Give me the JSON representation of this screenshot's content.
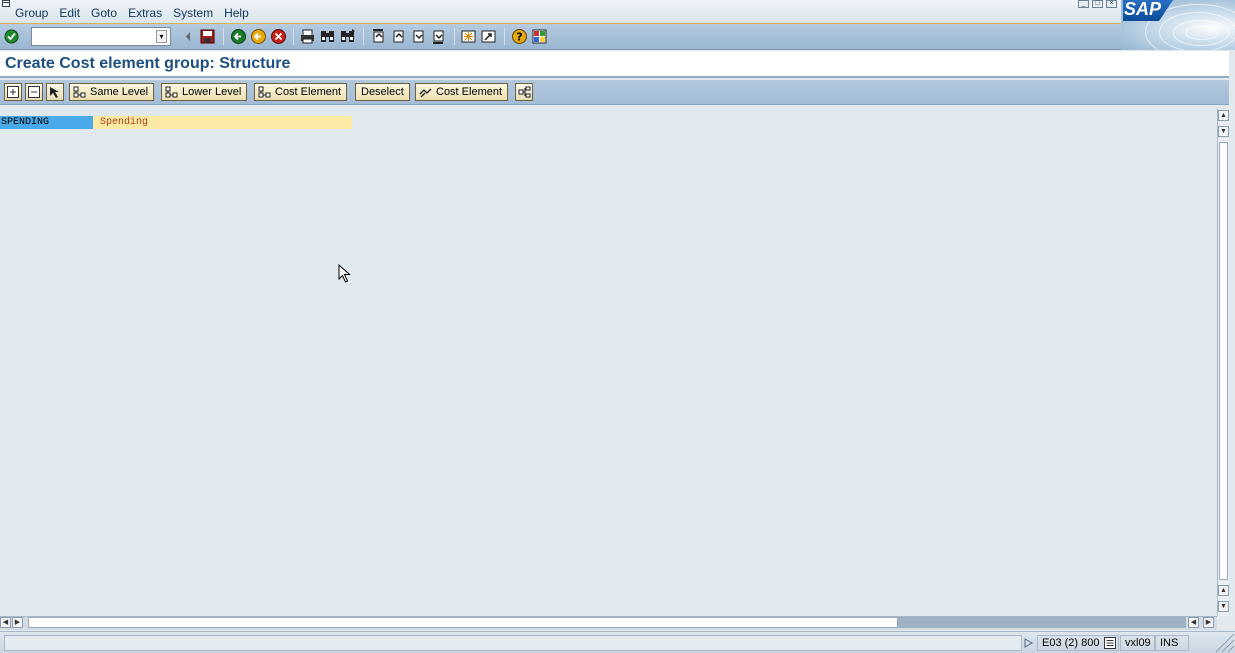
{
  "menubar": {
    "items": [
      "Group",
      "Edit",
      "Goto",
      "Extras",
      "System",
      "Help"
    ]
  },
  "branding": {
    "logo_text": "SAP"
  },
  "systoolbar": {
    "command_field_value": "",
    "icons": [
      "enter-icon",
      "back-icon",
      "save-icon",
      "back-nav-icon",
      "exit-icon",
      "cancel-icon",
      "print-icon",
      "find-icon",
      "find-next-icon",
      "first-page-icon",
      "previous-page-icon",
      "next-page-icon",
      "last-page-icon",
      "new-session-icon",
      "shortcut-icon",
      "help-icon",
      "customize-layout-icon"
    ]
  },
  "title": {
    "text": "Create Cost element group: Structure"
  },
  "apptoolbar": {
    "same_level": "Same Level",
    "lower_level": "Lower Level",
    "cost_element": "Cost Element",
    "deselect": "Deselect",
    "cost_element_2": "Cost Element"
  },
  "tree": {
    "node_key": "SPENDING",
    "node_text": "Spending"
  },
  "statusbar": {
    "system": "E03 (2) 800",
    "server": "vxl09",
    "mode": "INS"
  },
  "colors": {
    "node_key_bg": "#4aa9e8",
    "node_text_bg": "#fbe9a6",
    "title_color": "#1c4f82",
    "work_bg": "#e2e9ee"
  }
}
